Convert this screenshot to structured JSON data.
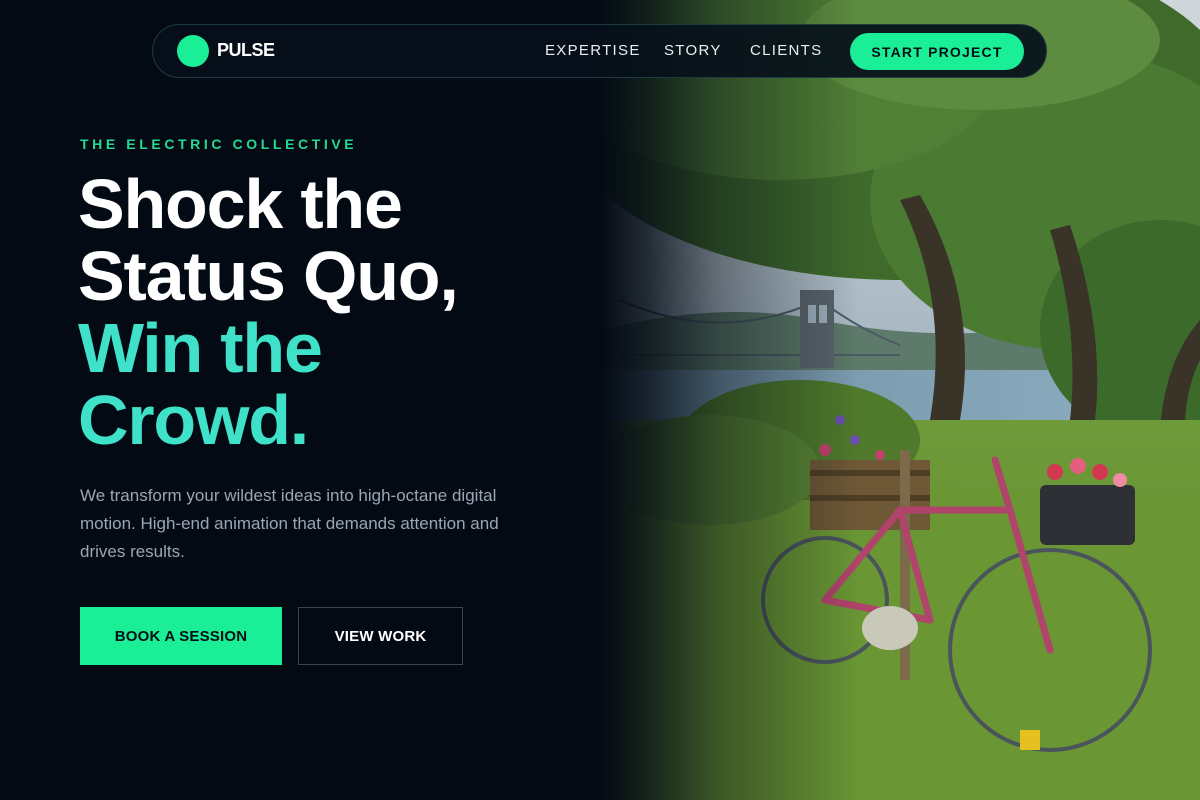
{
  "brand": {
    "name": "PULSE",
    "accent": "#1aee97",
    "headline_accent": "#3fe2c8",
    "background": "#030a14"
  },
  "nav": {
    "links": [
      {
        "label": "EXPERTISE"
      },
      {
        "label": "STORY"
      },
      {
        "label": "CLIENTS"
      }
    ],
    "cta_label": "START PROJECT"
  },
  "hero": {
    "eyebrow": "THE ELECTRIC COLLECTIVE",
    "headline_line1": "Shock the",
    "headline_line2": "Status Quo,",
    "headline_line3": "Win the",
    "headline_line4": "Crowd.",
    "lede": "We transform your wildest ideas into high-octane digital motion. High-end animation that demands attention and drives results.",
    "primary_button": "BOOK A SESSION",
    "secondary_button": "VIEW WORK"
  },
  "image": {
    "subject": "pink-bicycle-with-flower-baskets-under-trees-by-river-and-suspension-bridge"
  }
}
